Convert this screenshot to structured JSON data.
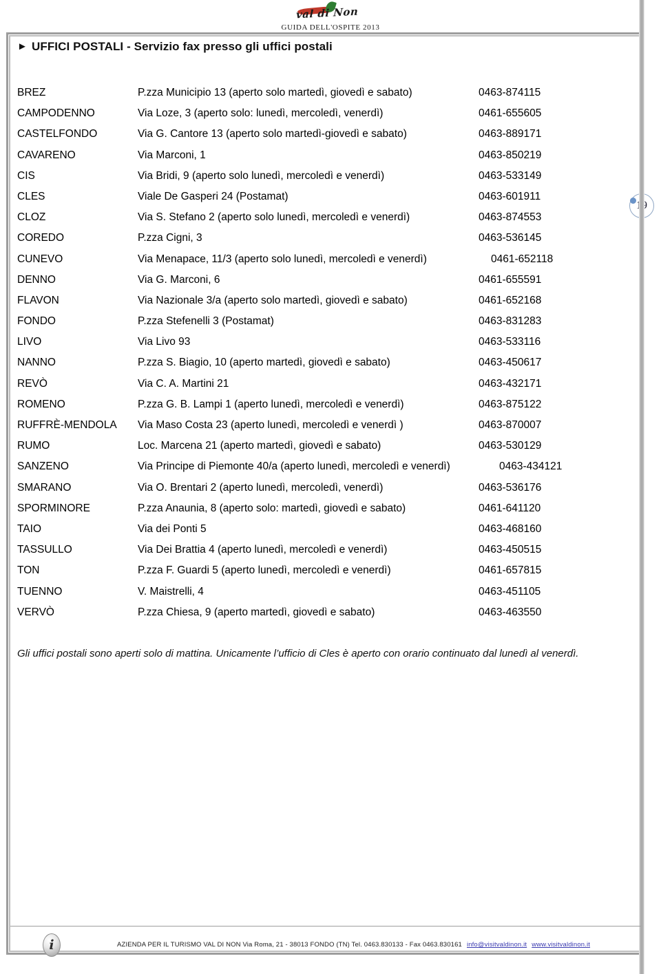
{
  "brand": {
    "logo_script": "val di Non",
    "logo_subtitle": "GUIDA DELL'OSPITE 2013",
    "logo_icon": "apple-leaf-logo"
  },
  "section": {
    "bullet_icon": "triangle-right-icon",
    "title": "UFFICI POSTALI - Servizio fax presso gli uffici postali"
  },
  "page_number": "19",
  "table": {
    "rows": [
      {
        "town": "BREZ",
        "address": "P.zza Municipio 13 (aperto solo martedì, giovedì e sabato)",
        "phone": "0463-874115"
      },
      {
        "town": "CAMPODENNO",
        "address": "Via Loze, 3  (aperto solo: lunedì, mercoledì, venerdì)",
        "phone": "0461-655605"
      },
      {
        "town": "CASTELFONDO",
        "address": "Via G. Cantore 13 (aperto solo martedì-giovedì e sabato)",
        "phone": "0463-889171"
      },
      {
        "town": "CAVARENO",
        "address": "Via Marconi, 1",
        "phone": "0463-850219"
      },
      {
        "town": "CIS",
        "address": "Via Bridi, 9 (aperto solo lunedì, mercoledì e venerdì)",
        "phone": "0463-533149"
      },
      {
        "town": "CLES",
        "address": "Viale De Gasperi 24 (Postamat)",
        "phone": "0463-601911"
      },
      {
        "town": "CLOZ",
        "address": "Via S. Stefano 2 (aperto solo lunedì, mercoledì e venerdì)",
        "phone": "0463-874553"
      },
      {
        "town": "COREDO",
        "address": "P.zza Cigni, 3",
        "phone": "0463-536145"
      },
      {
        "town": "CUNEVO",
        "address": "Via Menapace, 11/3 (aperto solo lunedì, mercoledì e venerdì)",
        "phone": "0461-652118",
        "shift": true
      },
      {
        "town": "DENNO",
        "address": "Via G. Marconi, 6",
        "phone": "0461-655591"
      },
      {
        "town": "FLAVON",
        "address": "Via Nazionale 3/a (aperto solo martedì, giovedì e sabato)",
        "phone": "0461-652168"
      },
      {
        "town": "FONDO",
        "address": "P.zza Stefenelli 3 (Postamat)",
        "phone": "0463-831283"
      },
      {
        "town": "LIVO",
        "address": "Via Livo 93",
        "phone": "0463-533116"
      },
      {
        "town": "NANNO",
        "address": "P.zza S. Biagio, 10 (aperto martedì, giovedì e sabato)",
        "phone": "0463-450617"
      },
      {
        "town": "REVÒ",
        "address": "Via C. A. Martini 21",
        "phone": "0463-432171"
      },
      {
        "town": "ROMENO",
        "address": "P.zza G. B. Lampi 1 (aperto lunedì, mercoledì e venerdì)",
        "phone": "0463-875122"
      },
      {
        "town": "RUFFRÈ-MENDOLA",
        "address": "Via Maso Costa 23 (aperto lunedì, mercoledì e venerdì )",
        "phone": "0463-870007"
      },
      {
        "town": "RUMO",
        "address": "Loc. Marcena 21 (aperto martedì, giovedì e sabato)",
        "phone": "0463-530129"
      },
      {
        "town": "SANZENO",
        "address": "Via Principe di Piemonte 40/a (aperto lunedì, mercoledì e venerdì)",
        "phone": "0463-434121",
        "tight": true
      },
      {
        "town": "SMARANO",
        "address": "Via O. Brentari 2 (aperto lunedì, mercoledì, venerdì)",
        "phone": "0463-536176"
      },
      {
        "town": "SPORMINORE",
        "address": "P.zza Anaunia, 8 (aperto solo: martedì, giovedì e sabato)",
        "phone": "0461-641120"
      },
      {
        "town": "TAIO",
        "address": "Via dei Ponti 5",
        "phone": "0463-468160"
      },
      {
        "town": "TASSULLO",
        "address": "Via Dei Brattia 4 (aperto lunedì, mercoledì e venerdì)",
        "phone": "0463-450515"
      },
      {
        "town": "TON",
        "address": "P.zza F. Guardi 5 (aperto lunedì, mercoledì e venerdì)",
        "phone": "0461-657815"
      },
      {
        "town": "TUENNO",
        "address": "V. Maistrelli, 4",
        "phone": "0463-451105"
      },
      {
        "town": "VERVÒ",
        "address": "P.zza Chiesa, 9 (aperto martedì, giovedì e sabato)",
        "phone": "0463-463550"
      }
    ]
  },
  "note": "Gli uffici postali sono aperti solo di  mattina. Unicamente l’ufficio di Cles è aperto con orario continuato dal lunedì al venerdì.",
  "footer": {
    "info_icon": "info-icon",
    "text_before": "AZIENDA PER IL TURISMO VAL DI NON Via Roma, 21 - 38013 FONDO (TN) Tel. 0463.830133 - Fax 0463.830161",
    "email": "info@visitvaldinon.it",
    "website": "www.visitvaldinon.it"
  }
}
